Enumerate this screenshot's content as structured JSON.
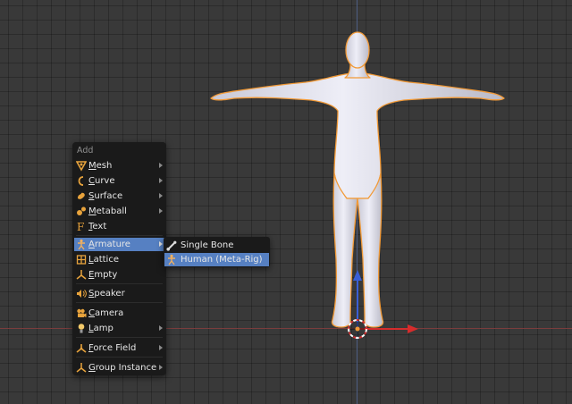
{
  "add_menu": {
    "title": "Add",
    "items": [
      {
        "label": "Mesh",
        "icon": "mesh-icon",
        "has_submenu": true
      },
      {
        "label": "Curve",
        "icon": "curve-icon",
        "has_submenu": true
      },
      {
        "label": "Surface",
        "icon": "surface-icon",
        "has_submenu": true
      },
      {
        "label": "Metaball",
        "icon": "metaball-icon",
        "has_submenu": true
      },
      {
        "label": "Text",
        "icon": "text-icon",
        "has_submenu": false
      },
      {
        "label": "Armature",
        "icon": "armature-icon",
        "has_submenu": true,
        "active": true
      },
      {
        "label": "Lattice",
        "icon": "lattice-icon",
        "has_submenu": false
      },
      {
        "label": "Empty",
        "icon": "empty-icon",
        "has_submenu": true
      },
      {
        "label": "Speaker",
        "icon": "speaker-icon",
        "has_submenu": false
      },
      {
        "label": "Camera",
        "icon": "camera-icon",
        "has_submenu": false
      },
      {
        "label": "Lamp",
        "icon": "lamp-icon",
        "has_submenu": true
      },
      {
        "label": "Force Field",
        "icon": "force-field-icon",
        "has_submenu": true
      },
      {
        "label": "Group Instance",
        "icon": "group-instance-icon",
        "has_submenu": true
      }
    ]
  },
  "armature_submenu": {
    "items": [
      {
        "label": "Single Bone",
        "icon": "bone-icon"
      },
      {
        "label": "Human (Meta-Rig)",
        "icon": "armature-icon",
        "active": true
      }
    ]
  },
  "colors": {
    "viewport_bg": "#393939",
    "menu_bg": "#1a1a1a",
    "highlight": "#5680c2",
    "icon_orange": "#e8a33c",
    "selection_outline": "#f29a37",
    "x_axis": "#d62c2c",
    "y_axis": "#3a5fd6"
  }
}
